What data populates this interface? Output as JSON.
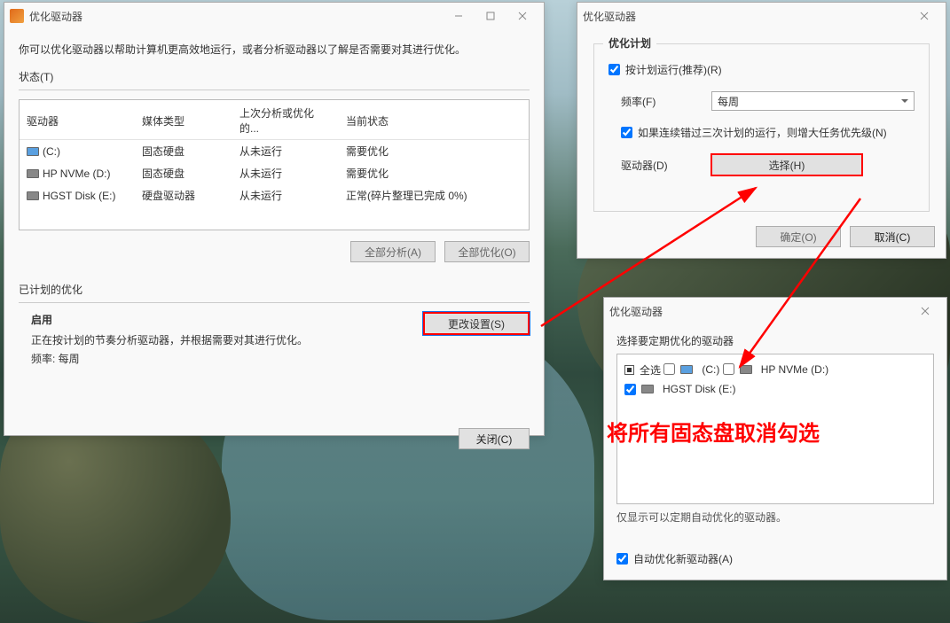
{
  "win1": {
    "title": "优化驱动器",
    "desc": "你可以优化驱动器以帮助计算机更高效地运行，或者分析驱动器以了解是否需要对其进行优化。",
    "statusLabel": "状态(T)",
    "cols": {
      "c1": "驱动器",
      "c2": "媒体类型",
      "c3": "上次分析或优化的...",
      "c4": "当前状态"
    },
    "rows": [
      {
        "name": "(C:)",
        "type": "固态硬盘",
        "last": "从未运行",
        "status": "需要优化",
        "icon": "sys"
      },
      {
        "name": "HP NVMe (D:)",
        "type": "固态硬盘",
        "last": "从未运行",
        "status": "需要优化",
        "icon": "hdd"
      },
      {
        "name": "HGST Disk (E:)",
        "type": "硬盘驱动器",
        "last": "从未运行",
        "status": "正常(碎片整理已完成 0%)",
        "icon": "hdd"
      }
    ],
    "analyzeAll": "全部分析(A)",
    "optimizeAll": "全部优化(O)",
    "scheduledLabel": "已计划的优化",
    "enable": "启用",
    "enableDesc": "正在按计划的节奏分析驱动器，并根据需要对其进行优化。",
    "freq": "频率: 每周",
    "changeSettings": "更改设置(S)",
    "close": "关闭(C)"
  },
  "win2": {
    "title": "优化驱动器",
    "groupTitle": "优化计划",
    "runOnSchedule": "按计划运行(推荐)(R)",
    "freqLabel": "频率(F)",
    "freqValue": "每周",
    "missedLabel": "如果连续错过三次计划的运行，则增大任务优先级(N)",
    "drivesLabel": "驱动器(D)",
    "choose": "选择(H)",
    "ok": "确定(O)",
    "cancel": "取消(C)"
  },
  "win3": {
    "title": "优化驱动器",
    "desc": "选择要定期优化的驱动器",
    "allLabel": "全选",
    "drives": [
      {
        "label": "(C:)",
        "checked": false,
        "icon": "sys"
      },
      {
        "label": "HP NVMe (D:)",
        "checked": false,
        "icon": "hdd"
      },
      {
        "label": "HGST Disk (E:)",
        "checked": true,
        "icon": "hdd"
      }
    ],
    "hint": "仅显示可以定期自动优化的驱动器。",
    "autoNew": "自动优化新驱动器(A)"
  },
  "anno": {
    "red": "将所有固态盘取消勾选"
  }
}
